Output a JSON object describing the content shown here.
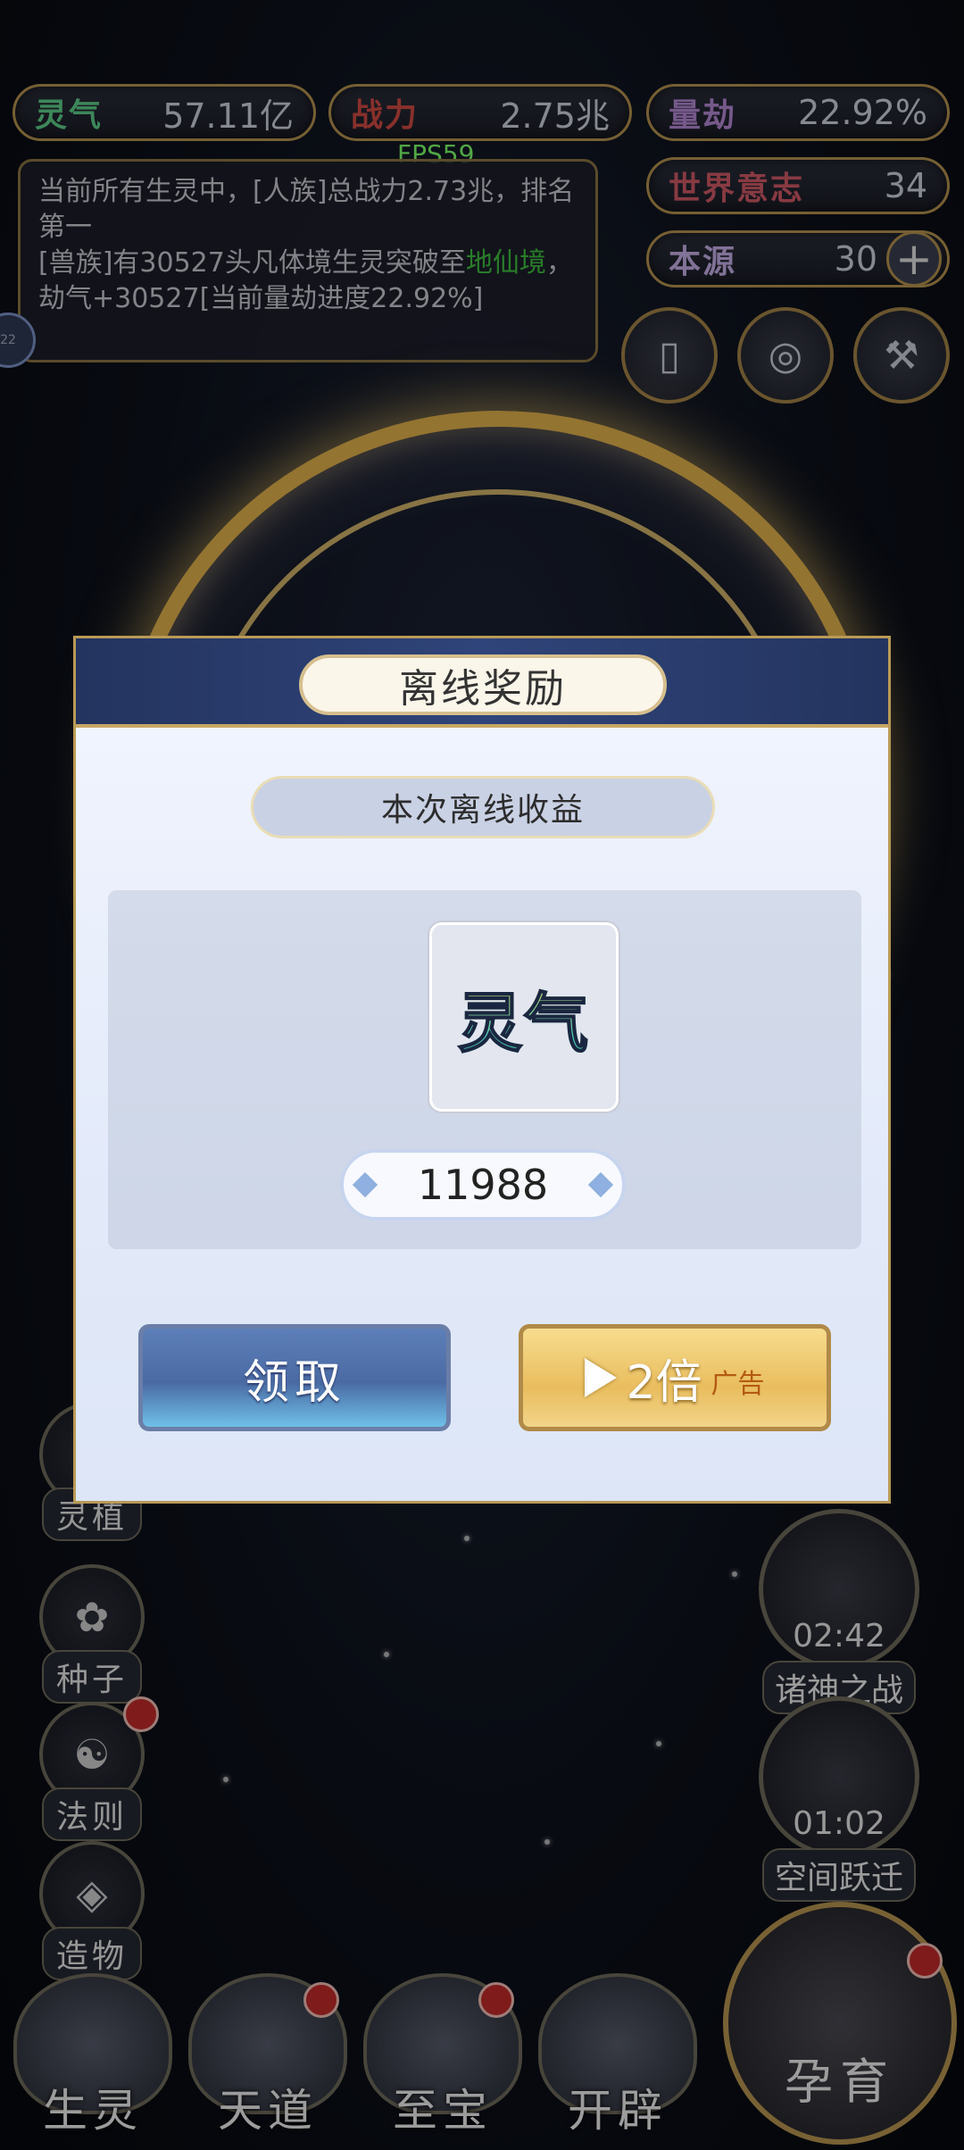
{
  "top_stats": {
    "lingqi": {
      "label": "灵气",
      "value": "57.11亿"
    },
    "zhanli": {
      "label": "战力",
      "value": "2.75兆"
    },
    "liangjie": {
      "label": "量劫",
      "value": "22.92%"
    },
    "shijie_yizhi": {
      "label": "世界意志",
      "value": "34"
    },
    "benyuan": {
      "label": "本源",
      "value": "30"
    }
  },
  "fps": "FPS59",
  "log": {
    "line1": "当前所有生灵中，[人族]总战力2.73兆，排名第一",
    "line2_prefix": "[兽族]有30527头凡体境生灵突破至",
    "line2_highlight": "地仙境",
    "line2_suffix": "，劫气+30527[当前量劫进度22.92%]"
  },
  "side_dot": "22",
  "left_menu": [
    {
      "label": "灵植",
      "icon": "plant-icon"
    },
    {
      "label": "种子",
      "icon": "seed-icon"
    },
    {
      "label": "法则",
      "icon": "law-icon"
    },
    {
      "label": "造物",
      "icon": "creation-icon"
    }
  ],
  "right_menu": [
    {
      "label": "诸神之战",
      "timer": "02:42"
    },
    {
      "label": "空间跃迁",
      "timer": "01:02"
    }
  ],
  "bottom_nav": [
    {
      "label": "生灵"
    },
    {
      "label": "天道"
    },
    {
      "label": "至宝"
    },
    {
      "label": "开辟"
    },
    {
      "label": "孕育"
    }
  ],
  "modal": {
    "title": "离线奖励",
    "subtitle": "本次离线收益",
    "item_name": "灵气",
    "quantity": "11988",
    "claim_label": "领取",
    "double_label": "2倍",
    "ad_label": "广告"
  },
  "colors": {
    "gold_border": "#b6934f",
    "modal_header": "#2f447a",
    "claim_blue": "#4a6aa4",
    "double_gold": "#e9bd5e",
    "highlight_green": "#3fbf3f",
    "fps_green": "#7bff6a"
  }
}
